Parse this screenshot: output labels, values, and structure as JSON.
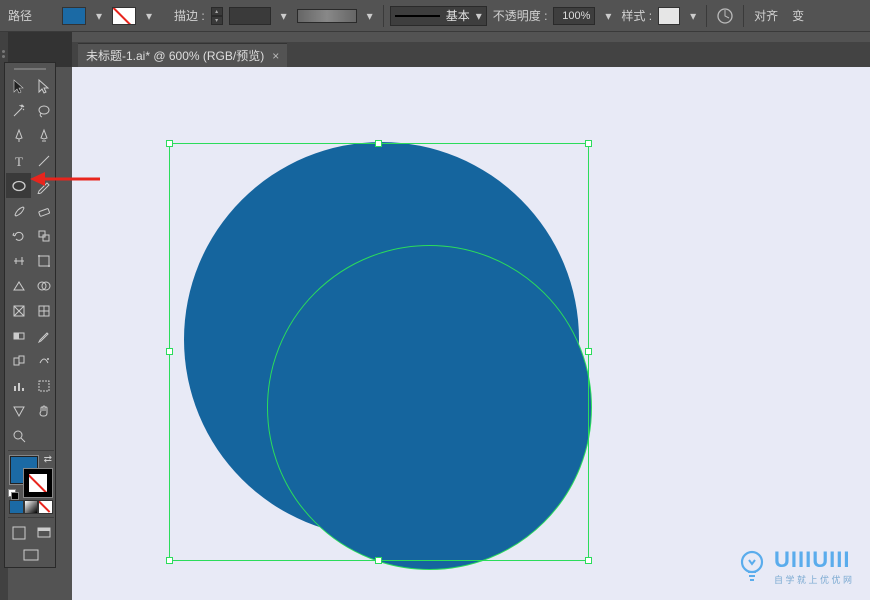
{
  "topbar": {
    "mode_label": "路径",
    "fill_color": "#1b6aa5",
    "stroke_label": "描边 :",
    "stroke_value": "",
    "profile_label": "基本",
    "opacity_label": "不透明度 :",
    "opacity_value": "100%",
    "style_label": "样式 :",
    "align_label": "对齐",
    "transform_label": "变"
  },
  "document": {
    "tab_title": "未标题-1.ai* @ 600% (RGB/预览)"
  },
  "toolbox": {
    "tools": [
      {
        "name": "selection-tool",
        "svg": "sel"
      },
      {
        "name": "direct-select-tool",
        "svg": "dsel"
      },
      {
        "name": "magic-wand-tool",
        "svg": "wand"
      },
      {
        "name": "lasso-tool",
        "svg": "lasso"
      },
      {
        "name": "pen-tool",
        "svg": "pen"
      },
      {
        "name": "curve-tool",
        "svg": "curve"
      },
      {
        "name": "type-tool",
        "svg": "type"
      },
      {
        "name": "line-tool",
        "svg": "line"
      },
      {
        "name": "ellipse-tool",
        "svg": "ellipse",
        "active": true
      },
      {
        "name": "pencil-tool",
        "svg": "pencil"
      },
      {
        "name": "brush-tool",
        "svg": "brush"
      },
      {
        "name": "eraser-tool",
        "svg": "eraser"
      },
      {
        "name": "rotate-tool",
        "svg": "rotate"
      },
      {
        "name": "scale-tool",
        "svg": "scale"
      },
      {
        "name": "width-tool",
        "svg": "width"
      },
      {
        "name": "free-trans-tool",
        "svg": "ftrans"
      },
      {
        "name": "shaper-tool",
        "svg": "shaper"
      },
      {
        "name": "shape-builder-tool",
        "svg": "sbuild"
      },
      {
        "name": "perspective-tool",
        "svg": "persp"
      },
      {
        "name": "mesh-tool",
        "svg": "mesh"
      },
      {
        "name": "gradient-tool",
        "svg": "grad"
      },
      {
        "name": "eyedropper-tool",
        "svg": "eye"
      },
      {
        "name": "blend-tool",
        "svg": "blend"
      },
      {
        "name": "symbol-tool",
        "svg": "symbol"
      },
      {
        "name": "column-graph-tool",
        "svg": "graph"
      },
      {
        "name": "artboard-tool",
        "svg": "artb"
      },
      {
        "name": "slice-tool",
        "svg": "slice"
      },
      {
        "name": "hand-tool",
        "svg": "hand"
      },
      {
        "name": "zoom-tool",
        "svg": "zoom"
      }
    ],
    "screen_mode_icon": "screen",
    "view_mode_icon": "view"
  },
  "artwork": {
    "fill": "#15659e",
    "selection_stroke": "#2bdc5b"
  },
  "watermark": {
    "brand": "UIIIUIII",
    "tagline": "自 学 就 上 优 优 网"
  }
}
